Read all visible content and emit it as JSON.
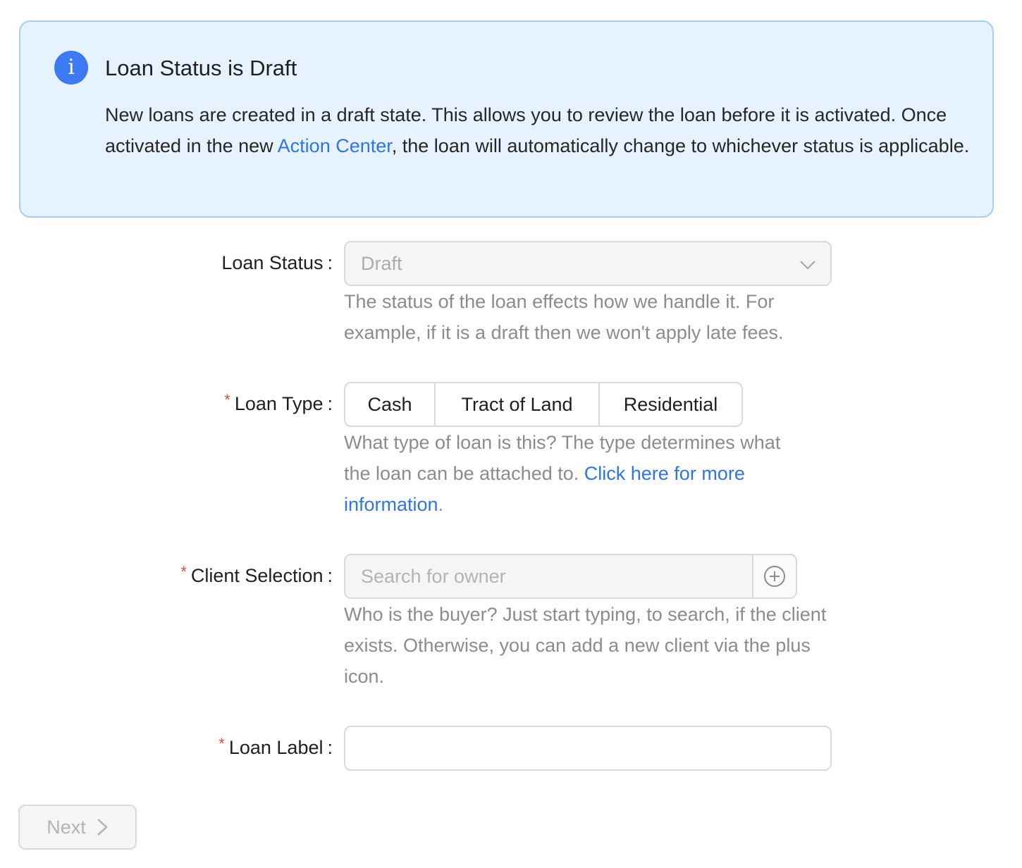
{
  "alert": {
    "icon": "info-icon",
    "icon_glyph": "i",
    "title": "Loan Status is Draft",
    "body_part1": "New loans are created in a draft state. This allows you to review the loan before it is activated. Once activated in the new ",
    "body_link": "Action Center",
    "body_part2": ", the loan will automatically change to whichever status is applicable."
  },
  "fields": {
    "loan_status": {
      "label": "Loan Status",
      "value": "Draft",
      "help": "The status of the loan effects how we handle it. For example, if it is a draft then we won't apply late fees."
    },
    "loan_type": {
      "label": "Loan Type",
      "required_mark": "*",
      "options": [
        "Cash",
        "Tract of Land",
        "Residential"
      ],
      "help_text": "What type of loan is this? The type determines what the loan can be attached to. ",
      "help_link": "Click here for more information",
      "help_end": "."
    },
    "client_selection": {
      "label": "Client Selection",
      "required_mark": "*",
      "placeholder": "Search for owner",
      "help": "Who is the buyer? Just start typing, to search, if the client exists. Otherwise, you can add a new client via the plus icon."
    },
    "loan_label": {
      "label": "Loan Label",
      "required_mark": "*",
      "value": ""
    }
  },
  "colon": ":",
  "next_button": {
    "label": "Next"
  },
  "colors": {
    "accent": "#2f74ef",
    "info_bg": "#e6f3fe",
    "info_border": "#a4cff9",
    "required": "#e34d46"
  }
}
